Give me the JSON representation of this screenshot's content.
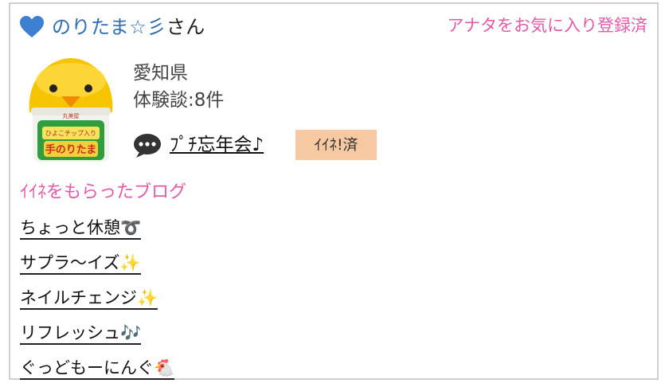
{
  "user": {
    "name": "のりたま☆彡",
    "suffix": "さん",
    "favorite_status": "アナタをお気に入り登録済",
    "prefecture": "愛知県",
    "experience_count": "体験談:8件"
  },
  "avatar": {
    "label_top": "丸美屋",
    "label_mid": "ひよこチップ入り",
    "label_main": "手のりたま"
  },
  "latest_post": {
    "title": "ﾌﾟﾁ忘年会♪",
    "like_status": "ｲｲﾈ!済"
  },
  "liked_blogs": {
    "heading": "ｲｲﾈをもらったブログ",
    "items": [
      {
        "title": "ちょっと休憩➰"
      },
      {
        "title": "サプラ〜イズ✨"
      },
      {
        "title": "ネイルチェンジ✨"
      },
      {
        "title": "リフレッシュ🎶"
      },
      {
        "title": "ぐっどもーにんぐ🐔"
      }
    ]
  },
  "colors": {
    "name_blue": "#2f6db5",
    "heart_blue": "#3d7fd0",
    "accent_pink": "#e35aa8",
    "badge_peach": "#f7c9a2"
  }
}
